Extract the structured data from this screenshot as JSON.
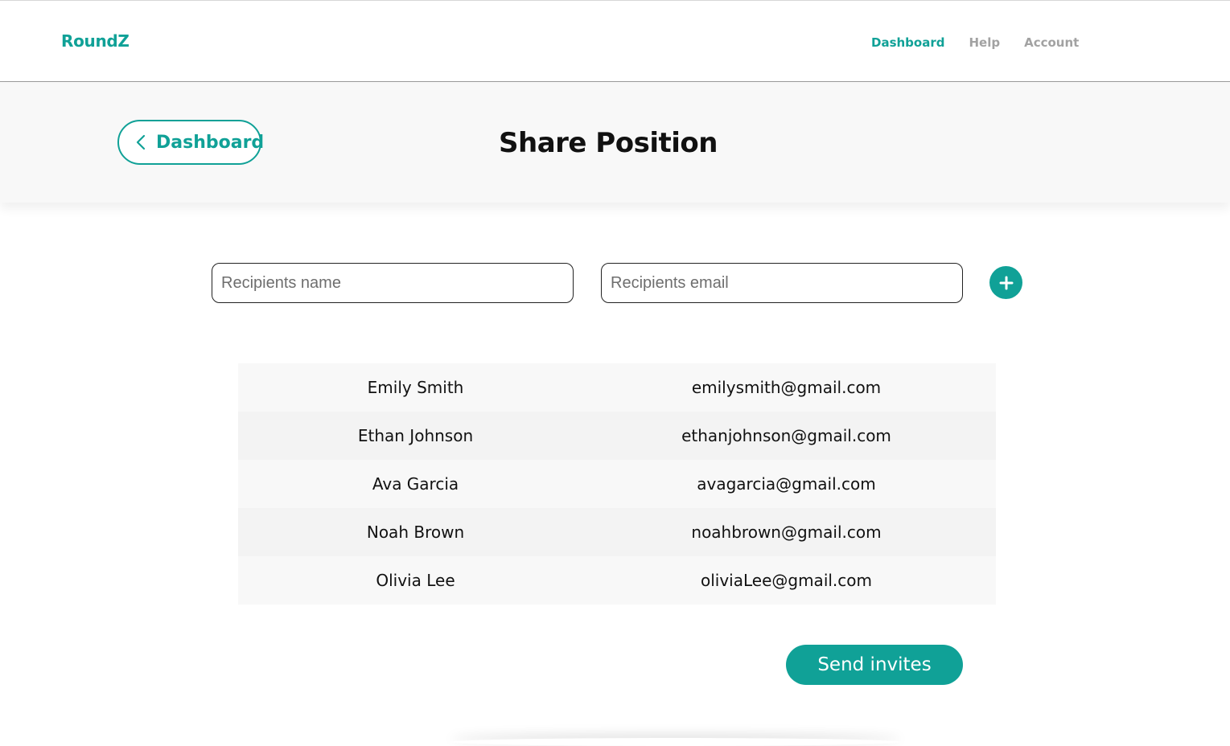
{
  "app": {
    "brand": "RoundZ"
  },
  "nav": {
    "links": [
      {
        "label": "Dashboard",
        "active": true
      },
      {
        "label": "Help",
        "active": false
      },
      {
        "label": "Account",
        "active": false
      }
    ]
  },
  "header": {
    "back_label": "Dashboard",
    "title": "Share Position"
  },
  "form": {
    "name_placeholder": "Recipients name",
    "email_placeholder": "Recipients email",
    "add_icon": "plus-icon"
  },
  "recipients": [
    {
      "name": "Emily Smith",
      "email": "emilysmith@gmail.com"
    },
    {
      "name": "Ethan Johnson",
      "email": "ethanjohnson@gmail.com"
    },
    {
      "name": "Ava Garcia",
      "email": "avagarcia@gmail.com"
    },
    {
      "name": "Noah Brown",
      "email": "noahbrown@gmail.com"
    },
    {
      "name": "Olivia Lee",
      "email": "oliviaLee@gmail.com"
    }
  ],
  "actions": {
    "send_label": "Send invites"
  },
  "colors": {
    "accent": "#10a197",
    "nav_inactive": "#a2a2a2",
    "header_bg": "#f8f8f8"
  }
}
